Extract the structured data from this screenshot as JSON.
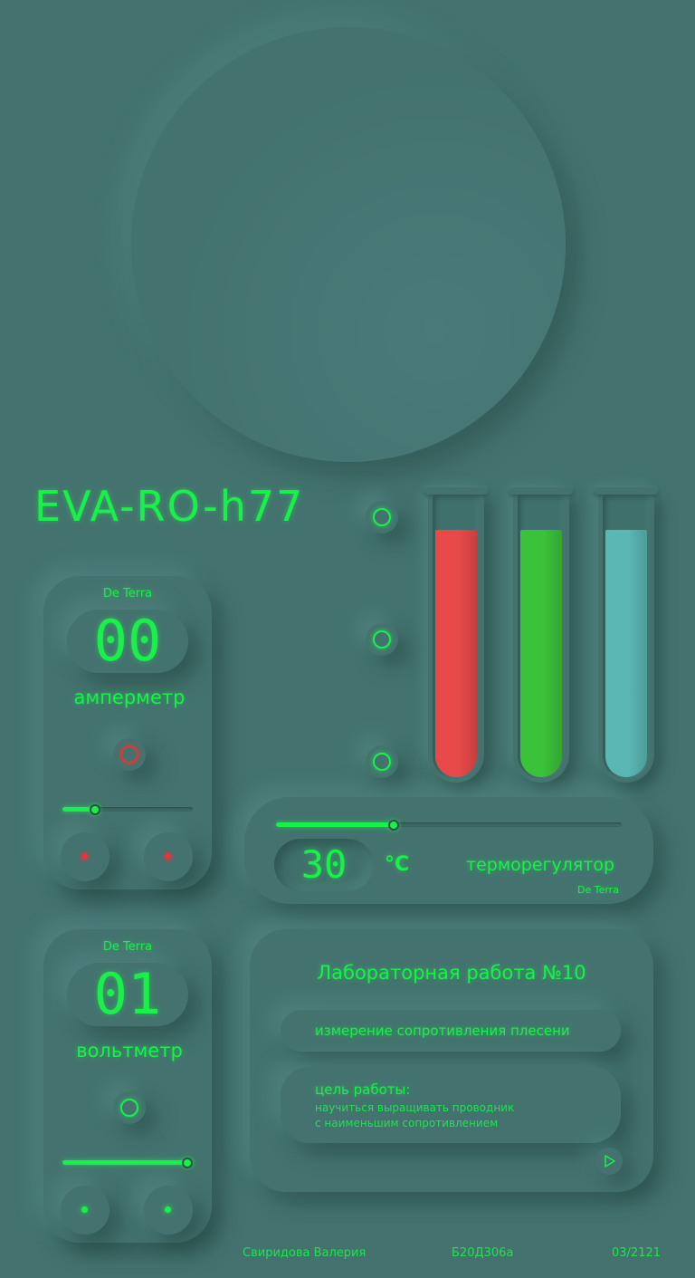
{
  "device": {
    "model": "EVA-RO-h77"
  },
  "ammeter": {
    "brand": "De Terra",
    "value": "00",
    "label": "амперметр",
    "indicator_color": "#e8333a",
    "slider_level": 0.25,
    "led_color": "#e8333a"
  },
  "voltmeter": {
    "brand": "De Terra",
    "value": "01",
    "label": "вольтметр",
    "indicator_color": "#19f04a",
    "slider_level": 1.0,
    "led_color": "#19f04a"
  },
  "tubes": [
    {
      "color": "#e84a4a",
      "level": 0.88
    },
    {
      "color": "#3cc23a",
      "level": 0.88
    },
    {
      "color": "#5ab7b4",
      "level": 0.88
    }
  ],
  "thermostat": {
    "value": "30",
    "unit": "°C",
    "label": "терморегулятор",
    "brand": "De Terra",
    "slider_level": 0.34
  },
  "lab": {
    "title": "Лабораторная работа №10",
    "topic": "измерение сопротивления плесени",
    "goal_heading": "цель работы:",
    "goal_line1": "научиться выращивать проводник",
    "goal_line2": "с наименьшим сопротивлением",
    "play_icon": "play-icon"
  },
  "footer": {
    "author": "Свиридова Валерия",
    "group": "Б20Д306а",
    "date": "03/2121"
  },
  "colors": {
    "accent": "#19f04a",
    "background": "#44736f",
    "danger": "#e8333a"
  }
}
